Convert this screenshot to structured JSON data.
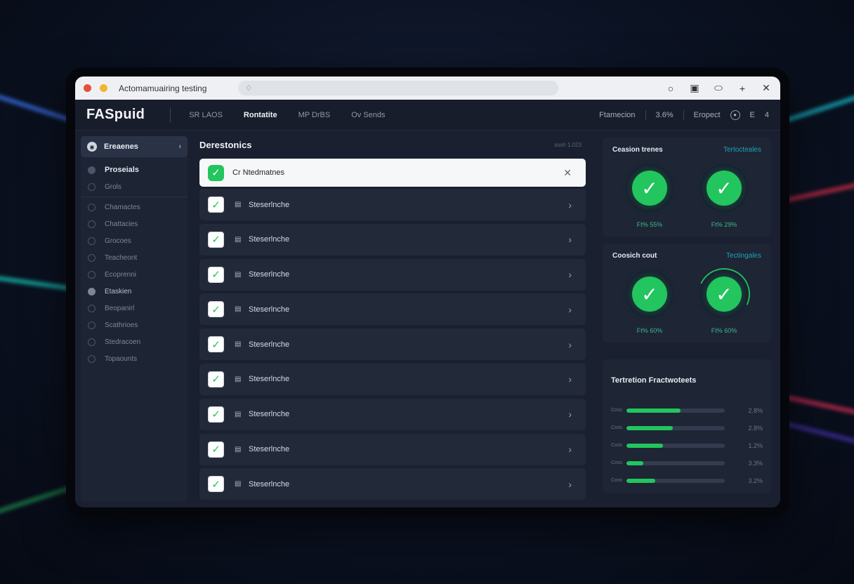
{
  "window": {
    "title": "Actomamuairing testing"
  },
  "app": {
    "logo": "FASpuid",
    "nav": [
      "SR LAOS",
      "Rontatite",
      "MP DrBS",
      "Ov Sends"
    ],
    "nav_active": 1,
    "right": {
      "item1": "Ftamecion",
      "item2": "3.6%",
      "item3": "Eropect",
      "item4": "E",
      "item5": "4"
    }
  },
  "sidebar": {
    "header": "Ereaenes",
    "items": [
      "Proseials",
      "Grols",
      "Chamactes",
      "Chattacies",
      "Grocoes",
      "Teacheont",
      "Ecoprenni",
      "Etaskien",
      "Beopanirl",
      "Scathrioes",
      "Stedracoen",
      "Topaounts"
    ]
  },
  "main": {
    "title": "Derestonics",
    "meta": "sssh  1.023",
    "selected_label": "Cr  Ntedmatnes",
    "row_label": "Steserlnche",
    "row_count": 9
  },
  "cards": [
    {
      "title": "Ceasion trenes",
      "link": "Tertocteales",
      "values": [
        "Ft% 55%",
        "Ft% 29%"
      ]
    },
    {
      "title": "Coosich cout",
      "link": "Tectingales",
      "values": [
        "Ft% 60%",
        "Ft% 60%"
      ]
    }
  ],
  "progress": {
    "title": "Tertretion Fractwoteets",
    "bars": [
      {
        "label": "Coss",
        "fill": 0.55,
        "value": "2.8%"
      },
      {
        "label": "Coss",
        "fill": 0.47,
        "value": "2.8%"
      },
      {
        "label": "Coss",
        "fill": 0.37,
        "value": "1.2%"
      },
      {
        "label": "Coss",
        "fill": 0.17,
        "value": "3.3%"
      },
      {
        "label": "Coss",
        "fill": 0.29,
        "value": "3.2%"
      }
    ]
  },
  "colors": {
    "accent": "#22c55e",
    "link": "#1fa3b3"
  }
}
